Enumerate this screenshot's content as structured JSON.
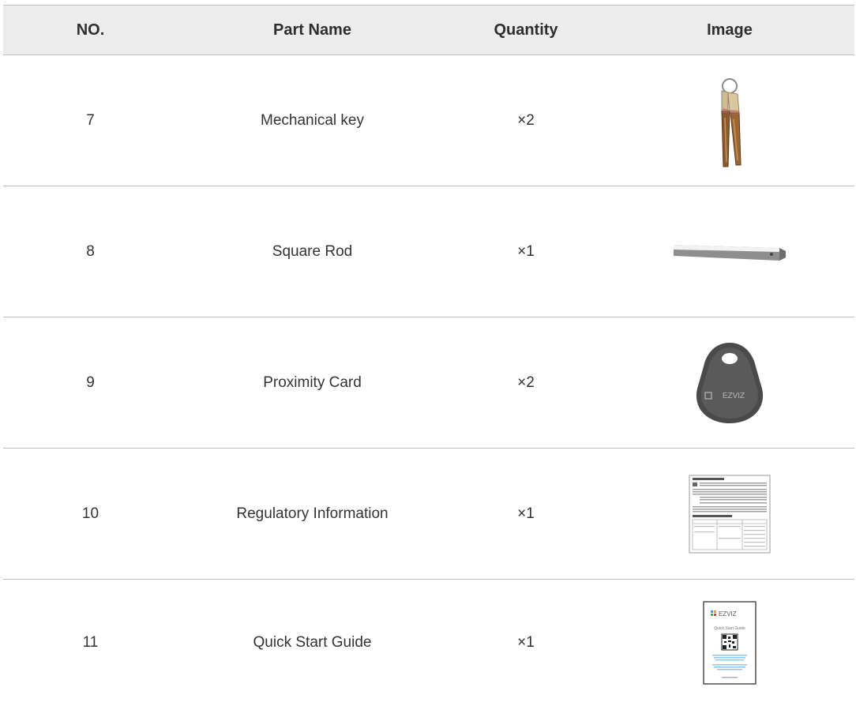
{
  "table": {
    "headers": {
      "no": "NO.",
      "part_name": "Part Name",
      "quantity": "Quantity",
      "image": "Image"
    },
    "rows": [
      {
        "no": "7",
        "part_name": "Mechanical key",
        "quantity": "×2",
        "image_icon": "mechanical-key-icon"
      },
      {
        "no": "8",
        "part_name": "Square Rod",
        "quantity": "×1",
        "image_icon": "square-rod-icon"
      },
      {
        "no": "9",
        "part_name": "Proximity Card",
        "quantity": "×2",
        "image_icon": "proximity-card-icon"
      },
      {
        "no": "10",
        "part_name": "Regulatory Information",
        "quantity": "×1",
        "image_icon": "regulatory-information-icon"
      },
      {
        "no": "11",
        "part_name": "Quick Start Guide",
        "quantity": "×1",
        "image_icon": "quick-start-guide-icon"
      }
    ]
  },
  "logos": {
    "card_brand": "EZVIZ",
    "guide_brand": "EZVIZ",
    "guide_title": "Quick Start Guide"
  },
  "colors": {
    "header_background": "#ececec",
    "divider": "#bdbdbd",
    "text": "#333333",
    "key_metal": "#c9b48a",
    "key_blade": "#8a5a2e",
    "rod_gray": "#8e8e8e",
    "card_gray": "#4a4a4a",
    "link_blue": "#3aa0e6"
  }
}
